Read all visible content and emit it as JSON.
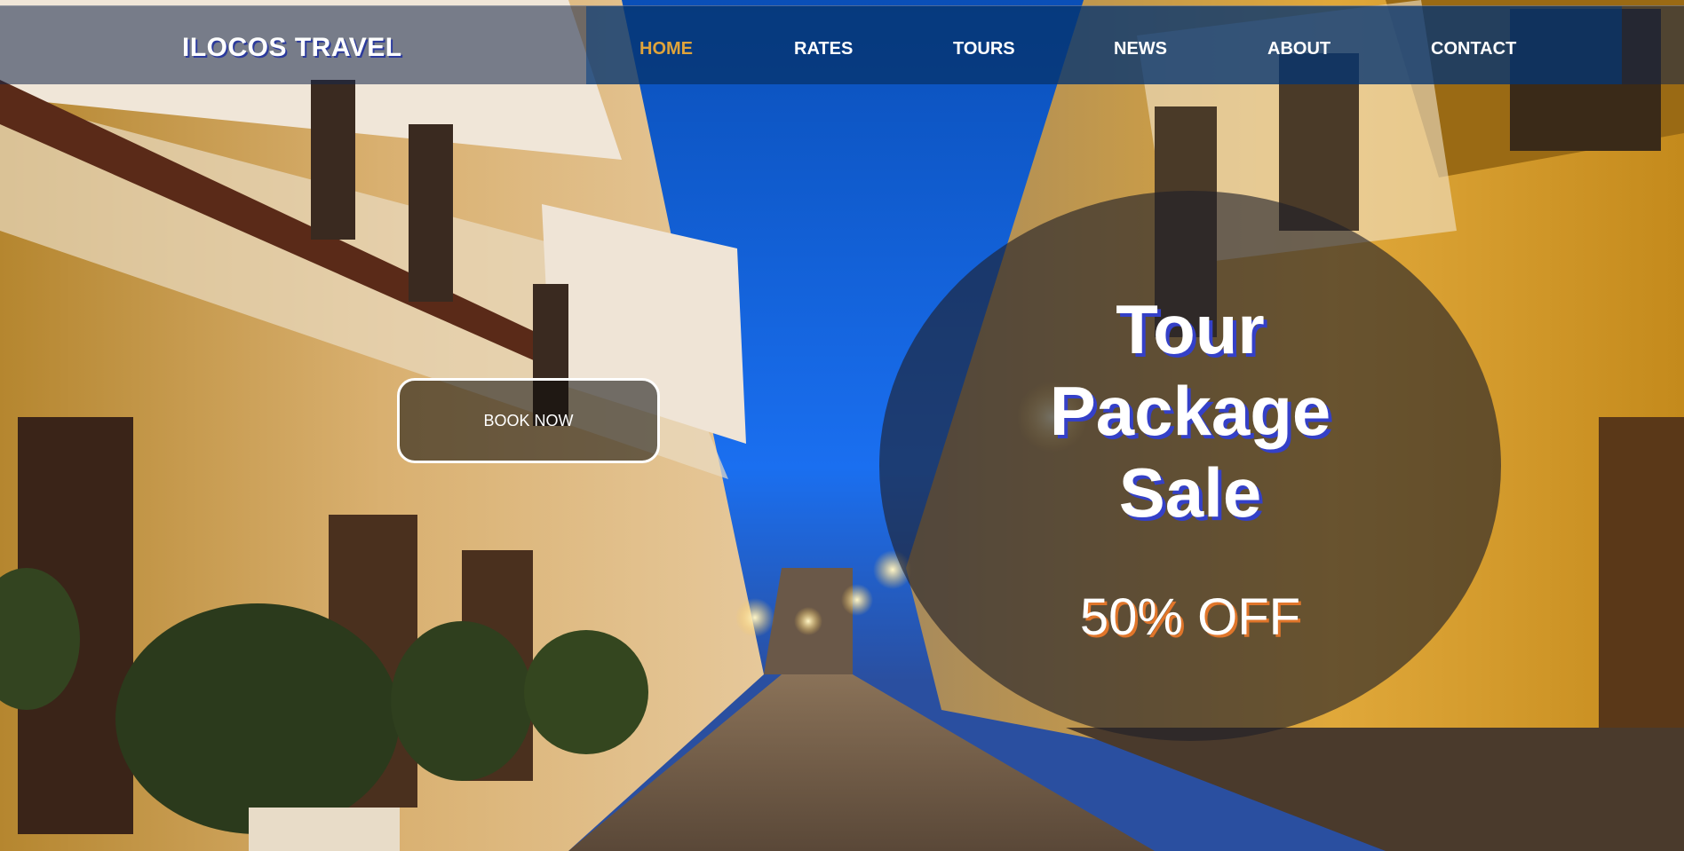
{
  "brand": {
    "name": "ILOCOS TRAVEL"
  },
  "nav": {
    "items": [
      {
        "label": "HOME",
        "active": true
      },
      {
        "label": "RATES",
        "active": false
      },
      {
        "label": "TOURS",
        "active": false
      },
      {
        "label": "NEWS",
        "active": false
      },
      {
        "label": "ABOUT",
        "active": false
      },
      {
        "label": "CONTACT",
        "active": false
      }
    ]
  },
  "hero": {
    "book_button": "BOOK NOW",
    "promo": {
      "title_lines": [
        "Tour",
        "Package",
        "Sale"
      ],
      "discount": "50% OFF"
    }
  },
  "colors": {
    "nav_active": "#e0a43a",
    "nav_band": "#003c82",
    "title_shadow": "#3440c8",
    "discount_shadow": "#e0752a"
  }
}
